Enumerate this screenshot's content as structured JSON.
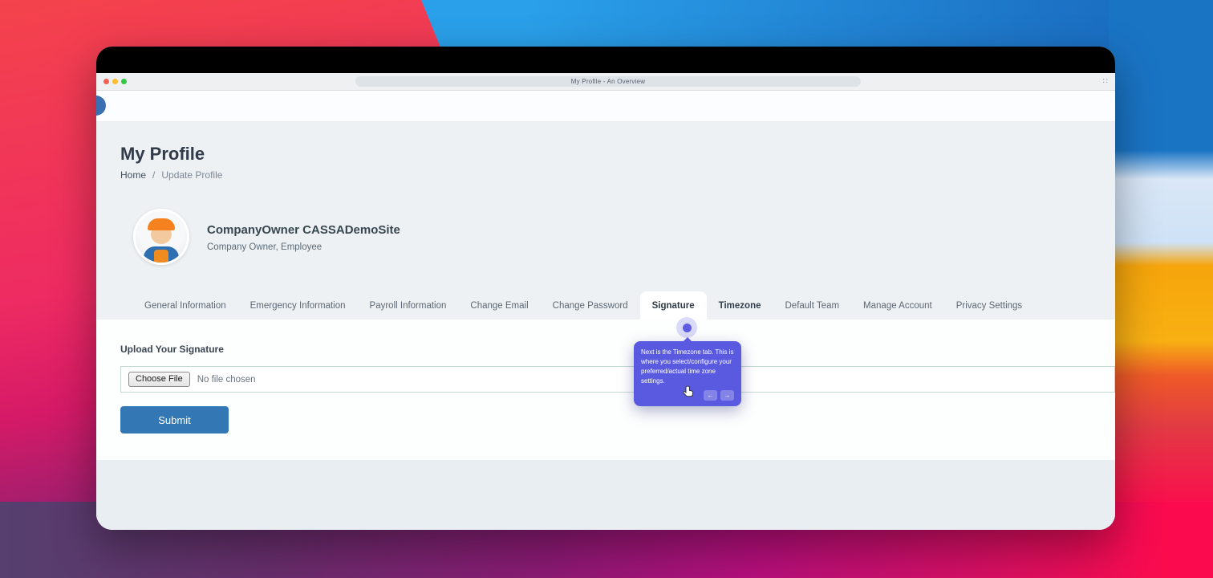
{
  "colors": {
    "accent_blue": "#3477b5",
    "tour_purple": "#5a5ae0",
    "beacon_purple": "#5d5ce2",
    "wallpaper": [
      "#f4434c",
      "#ee2b62",
      "#2aa0ea",
      "#1b6ec2",
      "#f6a50b",
      "#fb0c4e",
      "#5c3a70"
    ]
  },
  "window": {
    "title": "My Profile - An Overview",
    "resize_icon": "∷"
  },
  "page": {
    "title": "My Profile",
    "breadcrumb": {
      "home": "Home",
      "separator": "/",
      "current": "Update Profile"
    },
    "profile": {
      "name": "CompanyOwner CASSADemoSite",
      "roles": "Company Owner, Employee"
    },
    "tabs": [
      {
        "label": "General Information"
      },
      {
        "label": "Emergency Information"
      },
      {
        "label": "Payroll Information"
      },
      {
        "label": "Change Email"
      },
      {
        "label": "Change Password"
      },
      {
        "label": "Signature",
        "active": true
      },
      {
        "label": "Timezone",
        "highlighted": true
      },
      {
        "label": "Default Team"
      },
      {
        "label": "Manage Account"
      },
      {
        "label": "Privacy Settings"
      }
    ],
    "signature": {
      "label": "Upload Your Signature",
      "choose_file": "Choose File",
      "no_file": "No file chosen",
      "submit": "Submit"
    }
  },
  "tour": {
    "text": "Next is the Timezone tab. This is where you select/configure your preferred/actual time zone settings.",
    "back_arrow": "←",
    "next_arrow": "→"
  }
}
